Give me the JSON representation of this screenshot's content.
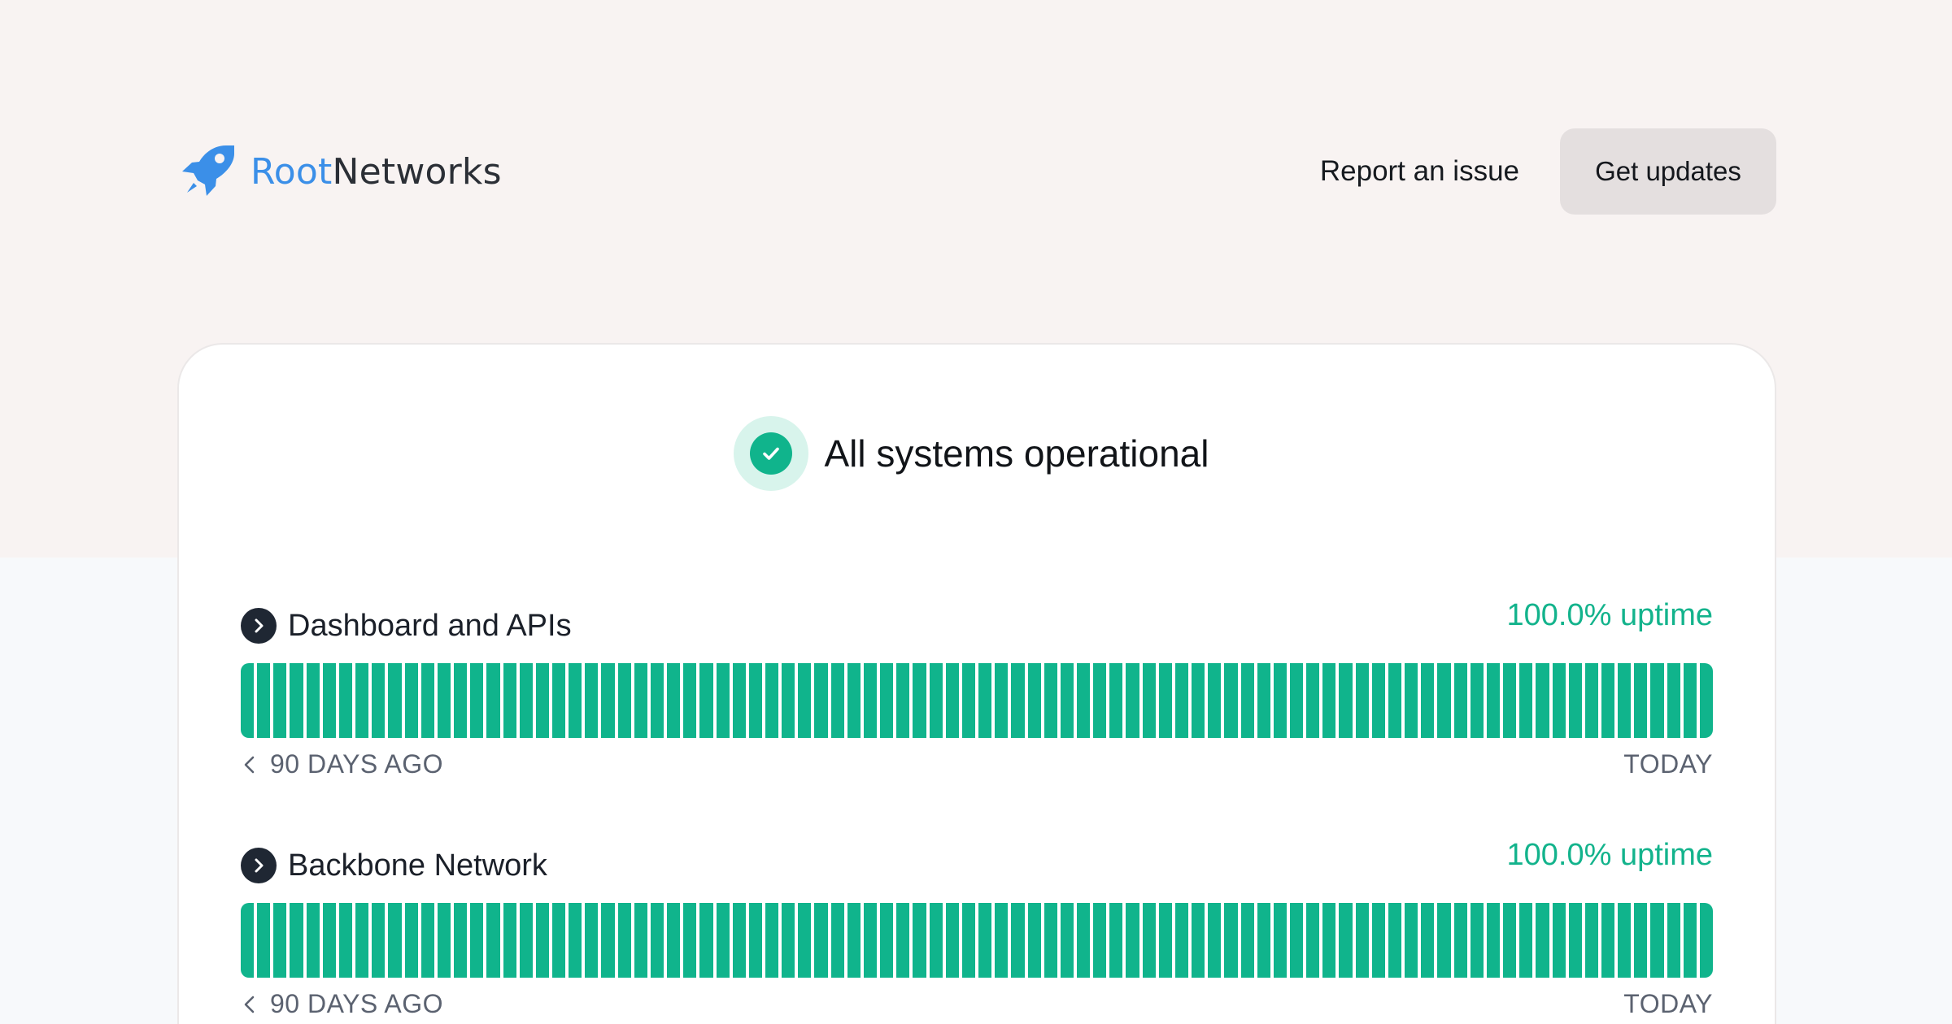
{
  "brand": {
    "name_part1": "Root",
    "name_part2": "Networks",
    "icon": "rocket-icon",
    "colors": {
      "primary": "#3b8fe8",
      "text": "#2b2f36"
    }
  },
  "nav": {
    "report_label": "Report an issue",
    "updates_label": "Get updates"
  },
  "status": {
    "icon": "check-circle-icon",
    "text": "All systems operational",
    "color": "#10b48c"
  },
  "components": [
    {
      "name": "Dashboard and APIs",
      "uptime": "100.0% uptime",
      "start_label": "90 DAYS AGO",
      "end_label": "TODAY",
      "days": 90,
      "bar_color": "#10b48c"
    },
    {
      "name": "Backbone Network",
      "uptime": "100.0% uptime",
      "start_label": "90 DAYS AGO",
      "end_label": "TODAY",
      "days": 90,
      "bar_color": "#10b48c"
    }
  ]
}
